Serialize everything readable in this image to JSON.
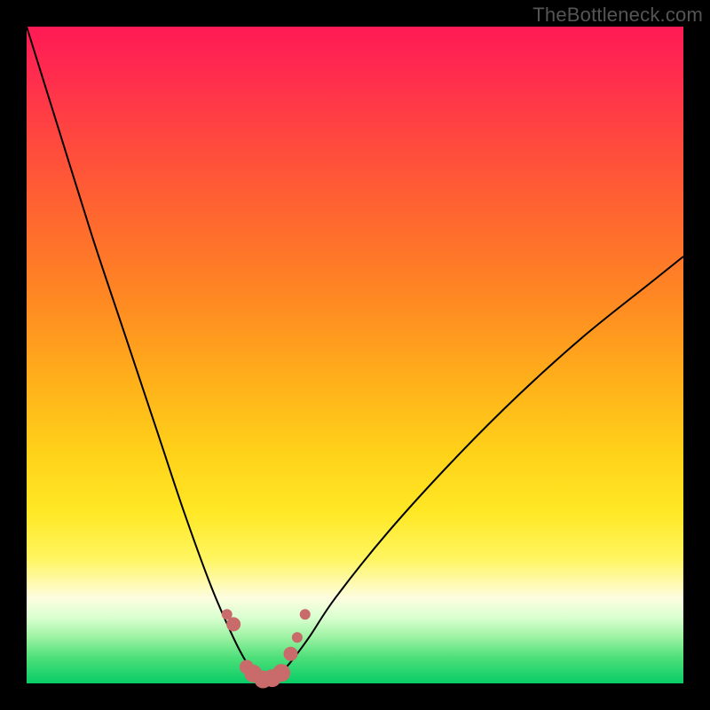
{
  "watermark": {
    "text": "TheBottleneck.com"
  },
  "chart_data": {
    "type": "line",
    "title": "",
    "xlabel": "",
    "ylabel": "",
    "xlim": [
      0,
      100
    ],
    "ylim": [
      0,
      100
    ],
    "series": [
      {
        "name": "bottleneck-curve",
        "x": [
          0,
          5,
          10,
          15,
          20,
          24,
          28,
          31,
          33,
          35,
          36,
          38,
          40,
          43,
          47,
          55,
          65,
          75,
          85,
          95,
          100
        ],
        "y": [
          100,
          84,
          68,
          53,
          38,
          26,
          15,
          8,
          4,
          1,
          0,
          1,
          3,
          7,
          13,
          23,
          34,
          44,
          53,
          61,
          65
        ]
      }
    ],
    "markers": {
      "name": "highlight-points",
      "color": "#c96b6b",
      "x": [
        30.5,
        31.5,
        33.5,
        34.5,
        36.0,
        37.4,
        38.8,
        40.2,
        41.2,
        42.4
      ],
      "y": [
        10.5,
        9.0,
        2.5,
        1.5,
        0.6,
        0.8,
        1.6,
        4.5,
        7.0,
        10.5
      ],
      "radius": [
        6,
        8,
        8,
        10,
        10,
        10,
        10,
        8,
        6,
        6
      ]
    },
    "gradient_bands": [
      {
        "color": "#ff1a55",
        "stop": 0
      },
      {
        "color": "#ff6a2e",
        "stop": 30
      },
      {
        "color": "#ffd21a",
        "stop": 65
      },
      {
        "color": "#fdfde0",
        "stop": 87
      },
      {
        "color": "#07cc66",
        "stop": 100
      }
    ]
  }
}
